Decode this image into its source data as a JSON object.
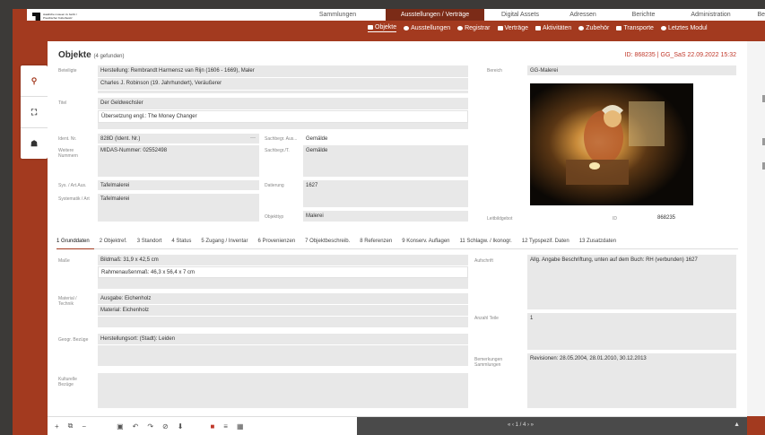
{
  "brand": {
    "logo_text": "staatliche museen zu berlin / Preußischer Kulturbesitz"
  },
  "main_nav": [
    {
      "label": "Sammlungen",
      "active": false
    },
    {
      "label": "Ausstellungen / Verträge",
      "active": true
    },
    {
      "label": "Digital Assets",
      "active": false
    },
    {
      "label": "Adressen",
      "active": false
    },
    {
      "label": "Berichte",
      "active": false
    },
    {
      "label": "Administration",
      "active": false
    },
    {
      "label": "Benutzer",
      "active": false
    }
  ],
  "sub_nav": [
    {
      "label": "Objekte",
      "icon": "image-icon",
      "active": true
    },
    {
      "label": "Ausstellungen",
      "icon": "eye-icon",
      "active": false
    },
    {
      "label": "Registrar",
      "icon": "circle-icon",
      "active": false
    },
    {
      "label": "Verträge",
      "icon": "document-icon",
      "active": false
    },
    {
      "label": "Aktivitäten",
      "icon": "flag-icon",
      "active": false
    },
    {
      "label": "Zubehör",
      "icon": "people-icon",
      "active": false
    },
    {
      "label": "Transporte",
      "icon": "truck-icon",
      "active": false
    },
    {
      "label": "Letztes Modul",
      "icon": "gear-icon",
      "active": false
    }
  ],
  "left_tools": [
    {
      "name": "search-icon",
      "glyph": "⚲"
    },
    {
      "name": "binoculars-icon",
      "glyph": "⛶"
    },
    {
      "name": "hierarchy-icon",
      "glyph": "☗"
    }
  ],
  "header": {
    "title": "Objekte",
    "count": "(4 gefunden)",
    "record_id": "ID: 868235 | GG_SaS 22.09.2022 15:32"
  },
  "fields": {
    "beteiligte_label": "Beteiligte",
    "beteiligte_1": "Herstellung: Rembrandt Harmensz van Rijn (1606 - 1669), Maler",
    "beteiligte_2": "Charles J. Robinson (19. Jahrhundert), Veräußerer",
    "titel_label": "Titel",
    "titel_1": "Der Geldwechsler",
    "titel_2": "Übersetzung engl.: The Money Changer",
    "ident_label": "Ident. Nr.",
    "ident_value": "828D (Ident. Nr.)",
    "ident_suffix": "···",
    "weitere_label": "Weitere Nummern",
    "weitere_value": "MIDAS-Nummer: 02552498",
    "sys_label": "Sys. / Art.Aus.",
    "sys_value": "Tafelmalerei",
    "systematik_label": "Systematik / Art",
    "systematik_value": "Tafelmalerei",
    "sachbegr_aus_label": "Sachbegr. Aus...",
    "sachbegr_aus_value": "Gemälde",
    "sachbegr_label": "Sachbegr./T.",
    "sachbegr_value": "Gemälde",
    "datierung_label": "Datierung",
    "datierung_value": "1627",
    "objekttyp_label": "Objekttyp",
    "objekttyp_value": "Malerei",
    "bereich_label": "Bereich",
    "bereich_value": "GG-Malerei",
    "leitbild_label": "Leitbildgebot",
    "id_label": "ID",
    "id_value": "868235"
  },
  "tabs": [
    "1 Grunddaten",
    "2 Objektref.",
    "3 Standort",
    "4 Status",
    "5 Zugang / Inventar",
    "6 Provenienzen",
    "7 Objektbeschreib.",
    "8 Referenzen",
    "9 Konserv. Auflagen",
    "11 Schlagw. / Ikonogr.",
    "12 Typspezif. Daten",
    "13 Zusatzdaten"
  ],
  "lower": {
    "masse_label": "Maße",
    "masse_1": "Bildmaß: 31,9 x 42,5 cm",
    "masse_2": "Rahmenaußenmaß: 46,3 x 56,4 x 7 cm",
    "material_label": "Material / Technik",
    "material_1": "Ausgabe: Eichenholz",
    "material_2": "Material: Eichenholz",
    "geogr_label": "Geogr. Bezüge",
    "geogr_value": "Herstellungsort: (Stadt): Leiden",
    "kulturelle_label": "Kulturelle Bezüge",
    "aufschrift_label": "Aufschrift",
    "aufschrift_value": "Allg. Angabe Beschriftung, unten auf dem Buch: RH (verbunden) 1627",
    "anzahl_label": "Anzahl Teile",
    "anzahl_value": "1",
    "bemerkungen_label": "Bemerkungen Sammlungen",
    "bemerkungen_value": "Revisionen: 28.05.2004, 28.01.2010, 30.12.2013"
  },
  "pager": {
    "text": "« ‹ 1 / 4 › »",
    "warn": "▲"
  },
  "colors": {
    "accent": "#a33a1f",
    "nav_active": "#7b2b17",
    "field_bg": "#e8e8e8"
  }
}
